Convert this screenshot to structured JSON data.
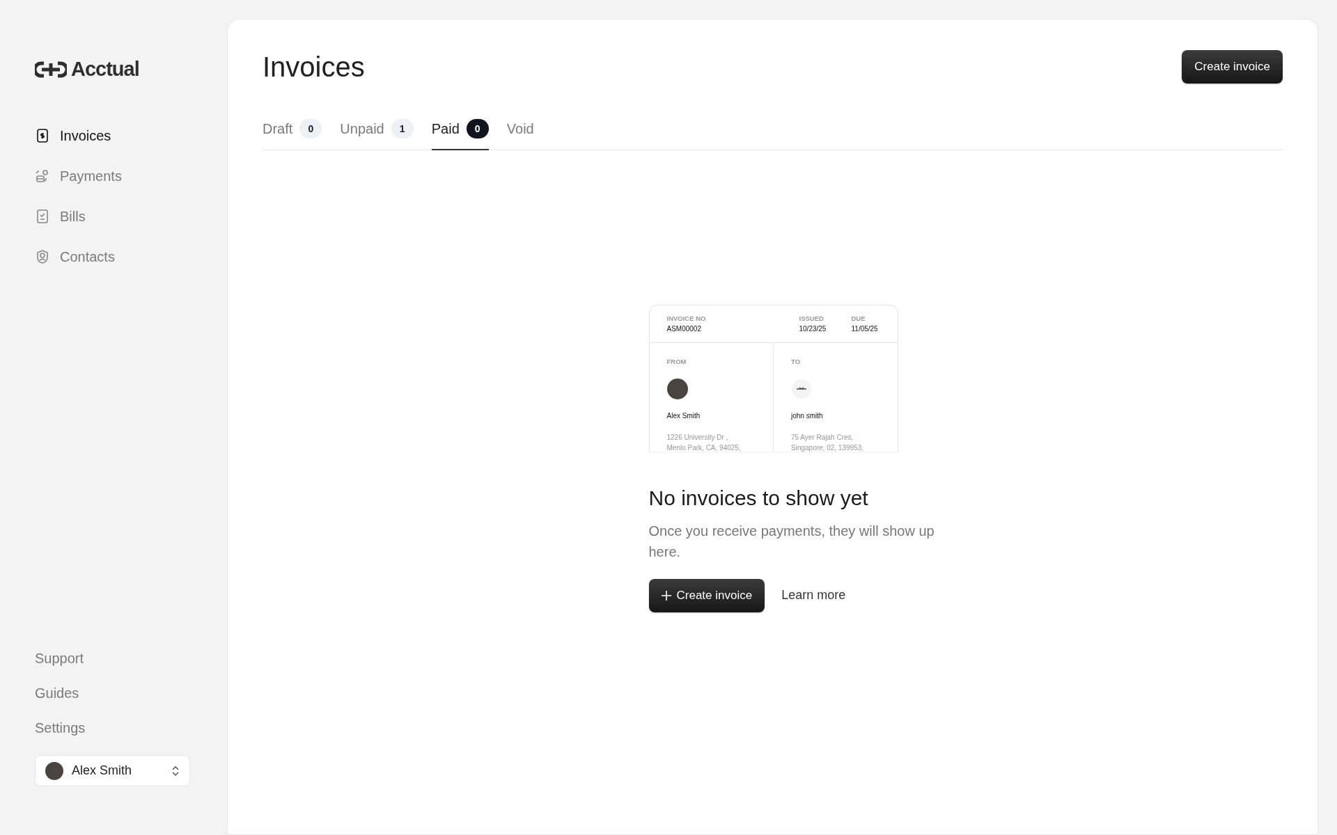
{
  "brand": {
    "name": "Acctual"
  },
  "sidebar": {
    "items": [
      {
        "label": "Invoices",
        "selected": true
      },
      {
        "label": "Payments",
        "selected": false
      },
      {
        "label": "Bills",
        "selected": false
      },
      {
        "label": "Contacts",
        "selected": false
      }
    ],
    "footer_links": [
      "Support",
      "Guides",
      "Settings"
    ],
    "user": {
      "name": "Alex Smith"
    }
  },
  "header": {
    "title": "Invoices",
    "button": "Create invoice"
  },
  "tabs": [
    {
      "label": "Draft",
      "count": "0",
      "selected": false
    },
    {
      "label": "Unpaid",
      "count": "1",
      "selected": false
    },
    {
      "label": "Paid",
      "count": "0",
      "selected": true
    },
    {
      "label": "Void",
      "selected": false
    }
  ],
  "empty_state": {
    "preview": {
      "invoice_no_label": "INVOICE NO",
      "invoice_no": "ASM00002",
      "issued_label": "ISSUED",
      "issued": "10/23/25",
      "due_label": "DUE",
      "due": "11/05/25",
      "from_label": "FROM",
      "from_name": "Alex Smith",
      "from_address": "1226 University Dr ,\nMenlo Park, CA, 94025,",
      "to_label": "TO",
      "to_name": "john smith",
      "to_address": "75 Ayer Rajah Cres,\nSingapore, 02, 139953,"
    },
    "heading": "No invoices to show yet",
    "text": "Once you receive payments, they will show up here.",
    "primary_button": "Create invoice",
    "link": "Learn more"
  }
}
